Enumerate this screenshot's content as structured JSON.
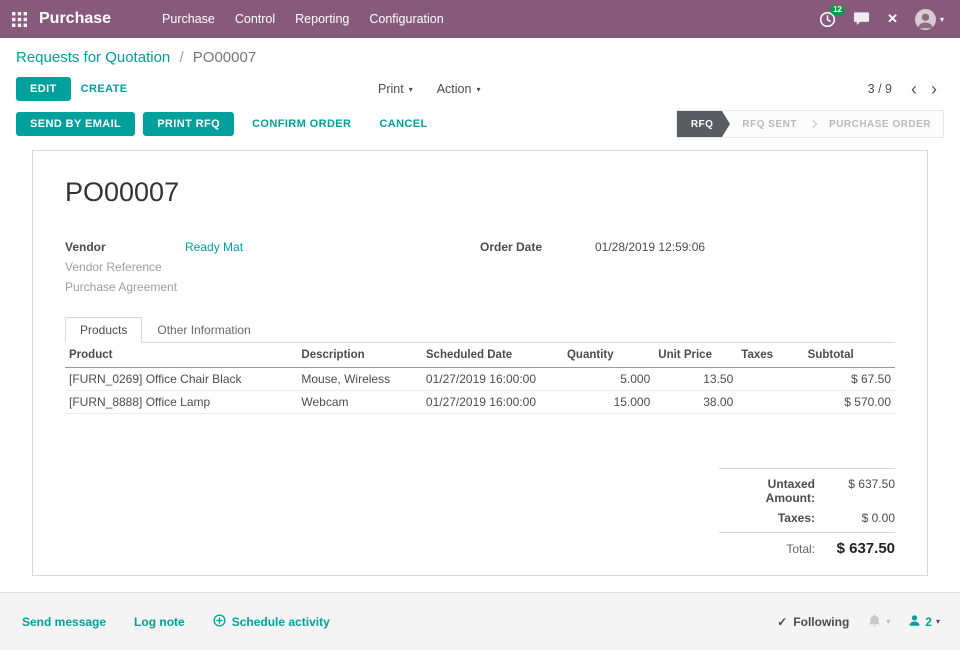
{
  "colors": {
    "navbar_bg": "#875A7B",
    "accent_teal": "#00A09D",
    "active_state_bg": "#5B5C61",
    "badge_green": "#00A04A",
    "text_dark": "#4C4C4C",
    "text_muted": "#9E9E9E"
  },
  "icons": {
    "apps": "grid-3x3",
    "activity_clock": "clock",
    "messages": "chat-bubble",
    "close": "✕",
    "caret": "▾",
    "pager_prev": "‹",
    "pager_next": "›",
    "schedule_plus": "circle-plus",
    "following_check": "✓",
    "notification_bell": "bell",
    "followers_person": "person"
  },
  "navbar": {
    "app_title": "Purchase",
    "menu": [
      "Purchase",
      "Control",
      "Reporting",
      "Configuration"
    ],
    "activity_badge": "12"
  },
  "breadcrumb": {
    "parent": "Requests for Quotation",
    "separator": "/",
    "current": "PO00007"
  },
  "control_panel": {
    "edit": "EDIT",
    "create": "CREATE",
    "print": "Print",
    "action": "Action",
    "pager": "3 / 9"
  },
  "statusbar": {
    "send_by_email": "SEND BY EMAIL",
    "print_rfq": "PRINT RFQ",
    "confirm_order": "CONFIRM ORDER",
    "cancel": "CANCEL",
    "states": [
      {
        "label": "RFQ",
        "active": true
      },
      {
        "label": "RFQ SENT",
        "active": false
      },
      {
        "label": "PURCHASE ORDER",
        "active": false
      }
    ]
  },
  "sheet": {
    "title": "PO00007",
    "fields": {
      "vendor_label": "Vendor",
      "vendor_value": "Ready Mat",
      "vendor_reference_label": "Vendor Reference",
      "purchase_agreement_label": "Purchase Agreement",
      "order_date_label": "Order Date",
      "order_date_value": "01/28/2019 12:59:06"
    },
    "tabs": [
      {
        "label": "Products",
        "active": true
      },
      {
        "label": "Other Information",
        "active": false
      }
    ],
    "table": {
      "headers": [
        "Product",
        "Description",
        "Scheduled Date",
        "Quantity",
        "Unit Price",
        "Taxes",
        "Subtotal"
      ],
      "rows": [
        {
          "product": "[FURN_0269] Office Chair Black",
          "description": "Mouse, Wireless",
          "scheduled_date": "01/27/2019 16:00:00",
          "quantity": "5.000",
          "unit_price": "13.50",
          "taxes": "",
          "subtotal": "$ 67.50"
        },
        {
          "product": "[FURN_8888] Office Lamp",
          "description": "Webcam",
          "scheduled_date": "01/27/2019 16:00:00",
          "quantity": "15.000",
          "unit_price": "38.00",
          "taxes": "",
          "subtotal": "$ 570.00"
        }
      ]
    },
    "totals": {
      "untaxed_label": "Untaxed Amount:",
      "untaxed_value": "$ 637.50",
      "taxes_label": "Taxes:",
      "taxes_value": "$ 0.00",
      "total_label": "Total:",
      "total_value": "$ 637.50"
    }
  },
  "chatter": {
    "send_message": "Send message",
    "log_note": "Log note",
    "schedule_activity": "Schedule activity",
    "following": "Following",
    "followers_count": "2"
  }
}
